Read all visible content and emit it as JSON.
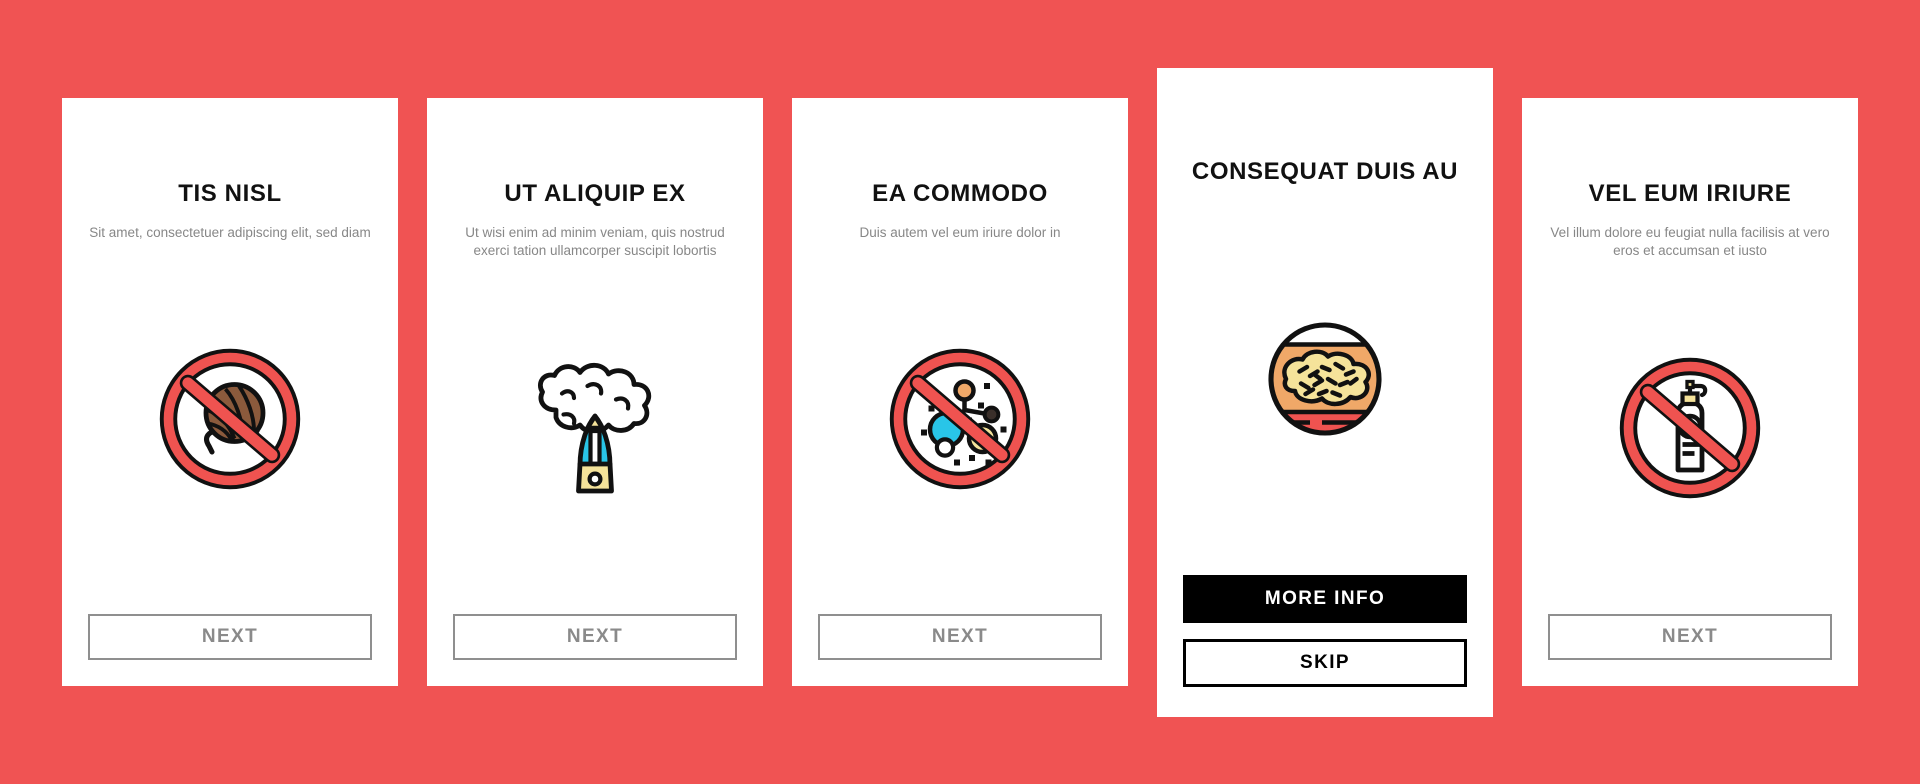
{
  "theme": {
    "background_color": "#f05353",
    "card_color": "#ffffff",
    "title_color": "#111111",
    "subtitle_color": "#878787",
    "next_button_color": "#8a8a8a",
    "primary_button_color": "#000000",
    "icon_red": "#ef5350",
    "icon_cyan": "#29c5e8",
    "icon_yellow": "#f5e39a",
    "icon_orange": "#f0a868",
    "icon_brown": "#8b5a3c"
  },
  "cards": [
    {
      "title": "TIS NISL",
      "subtitle": "Sit amet, consectetuer adipiscing elit, sed diam",
      "icon": "no-yarn-ball-icon",
      "buttons": [
        {
          "label": "NEXT",
          "style": "outline-gray",
          "name": "next-button"
        }
      ]
    },
    {
      "title": "UT ALIQUIP EX",
      "subtitle": "Ut wisi enim ad minim veniam, quis nostrud exerci tation ullamcorper suscipit lobortis",
      "icon": "humidifier-steam-icon",
      "buttons": [
        {
          "label": "NEXT",
          "style": "outline-gray",
          "name": "next-button"
        }
      ]
    },
    {
      "title": "EA COMMODO",
      "subtitle": "Duis autem vel eum iriure dolor in",
      "icon": "no-allergen-particles-icon",
      "buttons": [
        {
          "label": "NEXT",
          "style": "outline-gray",
          "name": "next-button"
        }
      ]
    },
    {
      "title": "CONSEQUAT DUIS AU",
      "subtitle": "",
      "icon": "dust-mite-petri-dish-icon",
      "featured": true,
      "buttons": [
        {
          "label": "MORE INFO",
          "style": "solid-black",
          "name": "more-info-button"
        },
        {
          "label": "SKIP",
          "style": "outline-black",
          "name": "skip-button"
        }
      ]
    },
    {
      "title": "VEL EUM IRIURE",
      "subtitle": "Vel illum dolore eu feugiat nulla facilisis at vero eros et accumsan et iusto",
      "icon": "no-lotion-bottle-icon",
      "buttons": [
        {
          "label": "NEXT",
          "style": "outline-gray",
          "name": "next-button"
        }
      ]
    }
  ]
}
